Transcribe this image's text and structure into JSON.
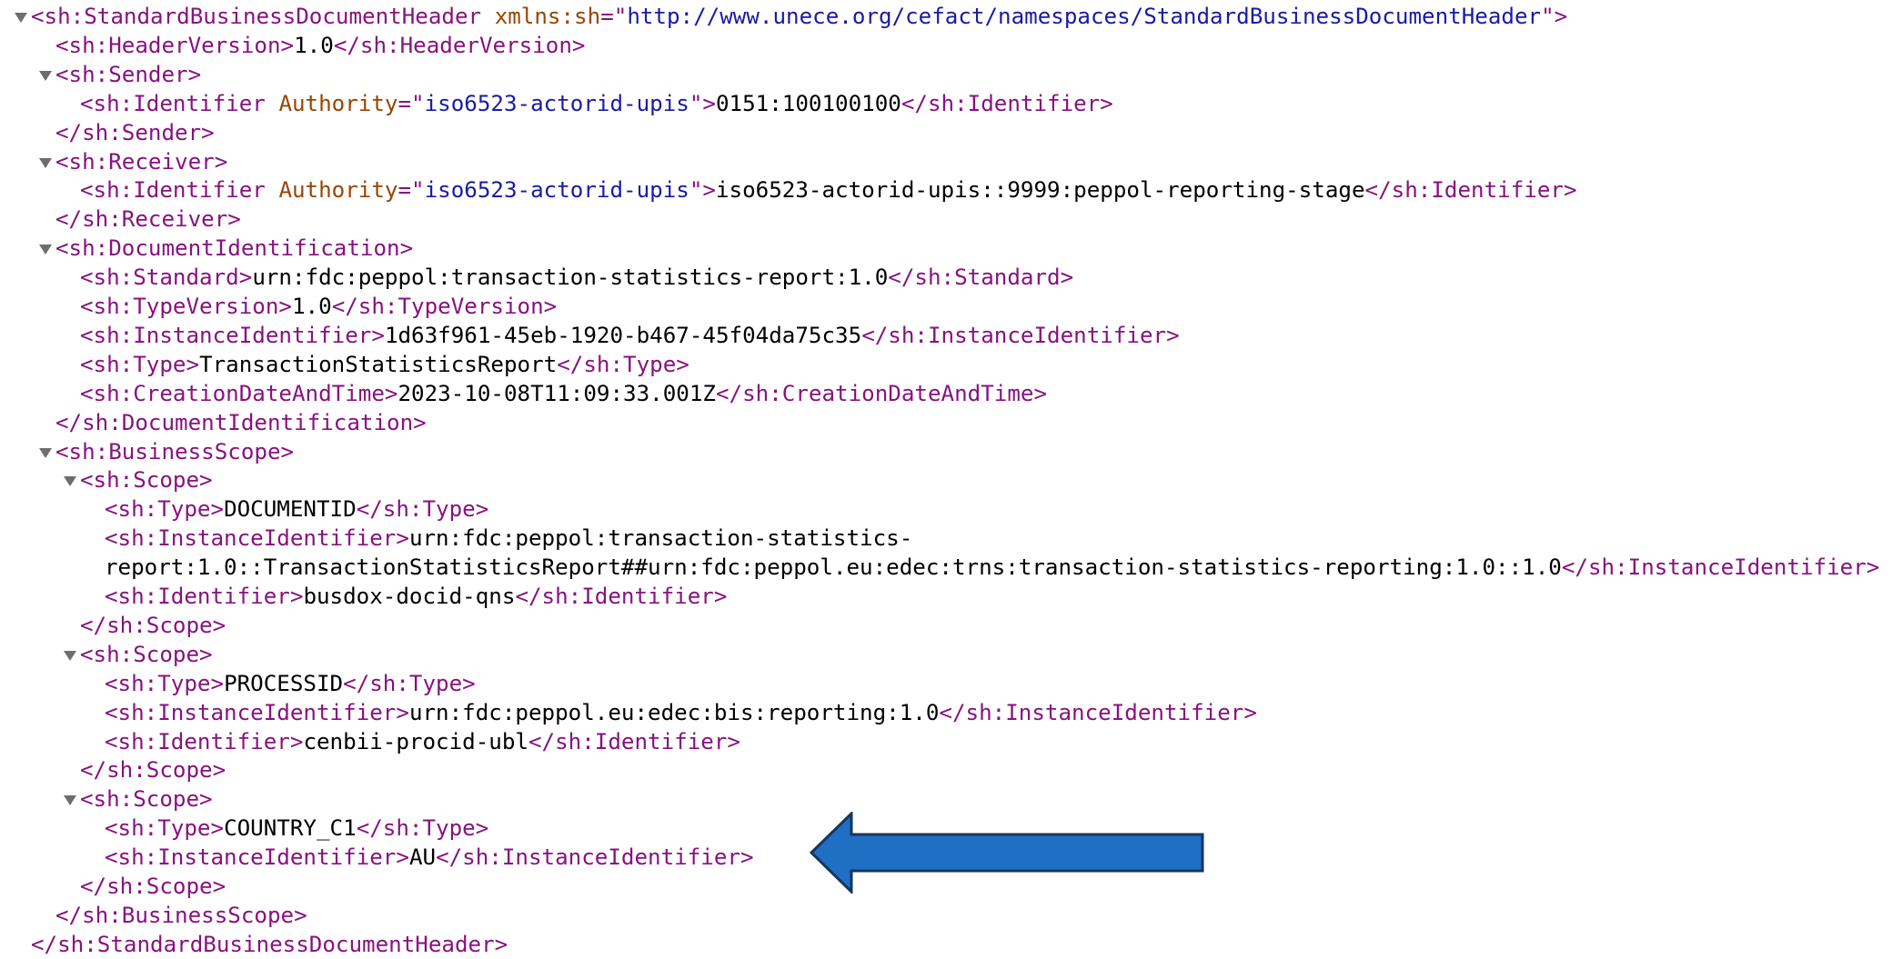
{
  "xml_tree": {
    "lines": [
      {
        "id": "root-open",
        "level": 0,
        "toggle": true,
        "segments": [
          {
            "k": "tag",
            "t": "<sh:StandardBusinessDocumentHeader "
          },
          {
            "k": "attr",
            "t": "xmlns:sh"
          },
          {
            "k": "tag",
            "t": "=\""
          },
          {
            "k": "val",
            "t": "http://www.unece.org/cefact/namespaces/StandardBusinessDocumentHeader"
          },
          {
            "k": "tag",
            "t": "\">"
          }
        ]
      },
      {
        "id": "header-version",
        "level": 1,
        "segments": [
          {
            "k": "tag",
            "t": "<sh:HeaderVersion>"
          },
          {
            "k": "txt",
            "t": "1.0"
          },
          {
            "k": "tag",
            "t": "</sh:HeaderVersion>"
          }
        ]
      },
      {
        "id": "sender-open",
        "level": 1,
        "toggle": true,
        "segments": [
          {
            "k": "tag",
            "t": "<sh:Sender>"
          }
        ]
      },
      {
        "id": "sender-identifier",
        "level": 2,
        "segments": [
          {
            "k": "tag",
            "t": "<sh:Identifier "
          },
          {
            "k": "attr",
            "t": "Authority"
          },
          {
            "k": "tag",
            "t": "=\""
          },
          {
            "k": "val",
            "t": "iso6523-actorid-upis"
          },
          {
            "k": "tag",
            "t": "\">"
          },
          {
            "k": "txt",
            "t": "0151:100100100"
          },
          {
            "k": "tag",
            "t": "</sh:Identifier>"
          }
        ]
      },
      {
        "id": "sender-close",
        "level": 1,
        "segments": [
          {
            "k": "tag",
            "t": "</sh:Sender>"
          }
        ]
      },
      {
        "id": "receiver-open",
        "level": 1,
        "toggle": true,
        "segments": [
          {
            "k": "tag",
            "t": "<sh:Receiver>"
          }
        ]
      },
      {
        "id": "receiver-identifier",
        "level": 2,
        "segments": [
          {
            "k": "tag",
            "t": "<sh:Identifier "
          },
          {
            "k": "attr",
            "t": "Authority"
          },
          {
            "k": "tag",
            "t": "=\""
          },
          {
            "k": "val",
            "t": "iso6523-actorid-upis"
          },
          {
            "k": "tag",
            "t": "\">"
          },
          {
            "k": "txt",
            "t": "iso6523-actorid-upis::9999:peppol-reporting-stage"
          },
          {
            "k": "tag",
            "t": "</sh:Identifier>"
          }
        ]
      },
      {
        "id": "receiver-close",
        "level": 1,
        "segments": [
          {
            "k": "tag",
            "t": "</sh:Receiver>"
          }
        ]
      },
      {
        "id": "docident-open",
        "level": 1,
        "toggle": true,
        "segments": [
          {
            "k": "tag",
            "t": "<sh:DocumentIdentification>"
          }
        ]
      },
      {
        "id": "standard",
        "level": 2,
        "segments": [
          {
            "k": "tag",
            "t": "<sh:Standard>"
          },
          {
            "k": "txt",
            "t": "urn:fdc:peppol:transaction-statistics-report:1.0"
          },
          {
            "k": "tag",
            "t": "</sh:Standard>"
          }
        ]
      },
      {
        "id": "type-version",
        "level": 2,
        "segments": [
          {
            "k": "tag",
            "t": "<sh:TypeVersion>"
          },
          {
            "k": "txt",
            "t": "1.0"
          },
          {
            "k": "tag",
            "t": "</sh:TypeVersion>"
          }
        ]
      },
      {
        "id": "instance-identifier",
        "level": 2,
        "segments": [
          {
            "k": "tag",
            "t": "<sh:InstanceIdentifier>"
          },
          {
            "k": "txt",
            "t": "1d63f961-45eb-1920-b467-45f04da75c35"
          },
          {
            "k": "tag",
            "t": "</sh:InstanceIdentifier>"
          }
        ]
      },
      {
        "id": "type",
        "level": 2,
        "segments": [
          {
            "k": "tag",
            "t": "<sh:Type>"
          },
          {
            "k": "txt",
            "t": "TransactionStatisticsReport"
          },
          {
            "k": "tag",
            "t": "</sh:Type>"
          }
        ]
      },
      {
        "id": "creation-date",
        "level": 2,
        "segments": [
          {
            "k": "tag",
            "t": "<sh:CreationDateAndTime>"
          },
          {
            "k": "txt",
            "t": "2023-10-08T11:09:33.001Z"
          },
          {
            "k": "tag",
            "t": "</sh:CreationDateAndTime>"
          }
        ]
      },
      {
        "id": "docident-close",
        "level": 1,
        "segments": [
          {
            "k": "tag",
            "t": "</sh:DocumentIdentification>"
          }
        ]
      },
      {
        "id": "businessscope-open",
        "level": 1,
        "toggle": true,
        "segments": [
          {
            "k": "tag",
            "t": "<sh:BusinessScope>"
          }
        ]
      },
      {
        "id": "scope1-open",
        "level": 2,
        "toggle": true,
        "segments": [
          {
            "k": "tag",
            "t": "<sh:Scope>"
          }
        ]
      },
      {
        "id": "scope1-type",
        "level": 3,
        "segments": [
          {
            "k": "tag",
            "t": "<sh:Type>"
          },
          {
            "k": "txt",
            "t": "DOCUMENTID"
          },
          {
            "k": "tag",
            "t": "</sh:Type>"
          }
        ]
      },
      {
        "id": "scope1-instance-a",
        "level": 3,
        "segments": [
          {
            "k": "tag",
            "t": "<sh:InstanceIdentifier>"
          },
          {
            "k": "txt",
            "t": "urn:fdc:peppol:transaction-statistics-"
          }
        ]
      },
      {
        "id": "scope1-instance-b",
        "level": 3,
        "segments": [
          {
            "k": "txt",
            "t": "report:1.0::TransactionStatisticsReport##urn:fdc:peppol.eu:edec:trns:transaction-statistics-reporting:1.0::1.0"
          },
          {
            "k": "tag",
            "t": "</sh:InstanceIdentifier>"
          }
        ]
      },
      {
        "id": "scope1-identifier",
        "level": 3,
        "segments": [
          {
            "k": "tag",
            "t": "<sh:Identifier>"
          },
          {
            "k": "txt",
            "t": "busdox-docid-qns"
          },
          {
            "k": "tag",
            "t": "</sh:Identifier>"
          }
        ]
      },
      {
        "id": "scope1-close",
        "level": 2,
        "segments": [
          {
            "k": "tag",
            "t": "</sh:Scope>"
          }
        ]
      },
      {
        "id": "scope2-open",
        "level": 2,
        "toggle": true,
        "segments": [
          {
            "k": "tag",
            "t": "<sh:Scope>"
          }
        ]
      },
      {
        "id": "scope2-type",
        "level": 3,
        "segments": [
          {
            "k": "tag",
            "t": "<sh:Type>"
          },
          {
            "k": "txt",
            "t": "PROCESSID"
          },
          {
            "k": "tag",
            "t": "</sh:Type>"
          }
        ]
      },
      {
        "id": "scope2-instance",
        "level": 3,
        "segments": [
          {
            "k": "tag",
            "t": "<sh:InstanceIdentifier>"
          },
          {
            "k": "txt",
            "t": "urn:fdc:peppol.eu:edec:bis:reporting:1.0"
          },
          {
            "k": "tag",
            "t": "</sh:InstanceIdentifier>"
          }
        ]
      },
      {
        "id": "scope2-identifier",
        "level": 3,
        "segments": [
          {
            "k": "tag",
            "t": "<sh:Identifier>"
          },
          {
            "k": "txt",
            "t": "cenbii-procid-ubl"
          },
          {
            "k": "tag",
            "t": "</sh:Identifier>"
          }
        ]
      },
      {
        "id": "scope2-close",
        "level": 2,
        "segments": [
          {
            "k": "tag",
            "t": "</sh:Scope>"
          }
        ]
      },
      {
        "id": "scope3-open",
        "level": 2,
        "toggle": true,
        "segments": [
          {
            "k": "tag",
            "t": "<sh:Scope>"
          }
        ]
      },
      {
        "id": "scope3-type",
        "level": 3,
        "segments": [
          {
            "k": "tag",
            "t": "<sh:Type>"
          },
          {
            "k": "txt",
            "t": "COUNTRY_C1"
          },
          {
            "k": "tag",
            "t": "</sh:Type>"
          }
        ]
      },
      {
        "id": "scope3-instance",
        "level": 3,
        "segments": [
          {
            "k": "tag",
            "t": "<sh:InstanceIdentifier>"
          },
          {
            "k": "txt",
            "t": "AU"
          },
          {
            "k": "tag",
            "t": "</sh:InstanceIdentifier>"
          }
        ]
      },
      {
        "id": "scope3-close",
        "level": 2,
        "segments": [
          {
            "k": "tag",
            "t": "</sh:Scope>"
          }
        ]
      },
      {
        "id": "businessscope-close",
        "level": 1,
        "segments": [
          {
            "k": "tag",
            "t": "</sh:BusinessScope>"
          }
        ]
      },
      {
        "id": "root-close",
        "level": 0,
        "segments": [
          {
            "k": "tag",
            "t": "</sh:StandardBusinessDocumentHeader>"
          }
        ]
      }
    ]
  },
  "annotation": {
    "icon": "left-arrow-icon",
    "fill": "#1f6fc5",
    "stroke": "#17365d"
  }
}
